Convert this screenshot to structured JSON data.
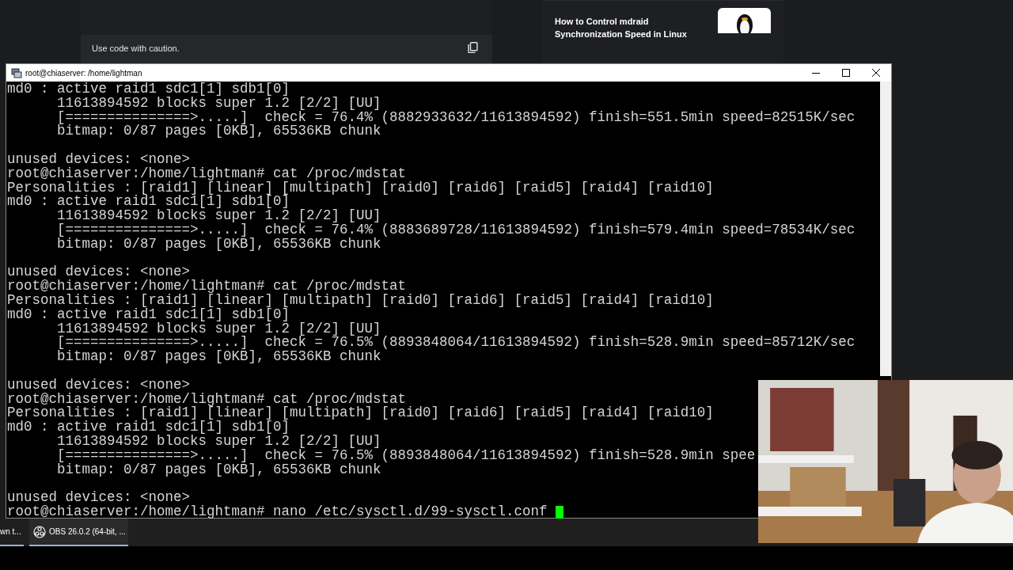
{
  "browser": {
    "code_note": "Use code with caution.",
    "article": {
      "title_lines": [
        "How to Control mdraid",
        "Synchronization Speed in Linux"
      ]
    }
  },
  "window": {
    "title": "root@chiaserver: /home/lightman"
  },
  "terminal": {
    "blocks": [
      [
        "md0 : active raid1 sdc1[1] sdb1[0]",
        "      11613894592 blocks super 1.2 [2/2] [UU]",
        "      [===============>.....]  check = 76.4% (8882933632/11613894592) finish=551.5min speed=82515K/sec",
        "      bitmap: 0/87 pages [0KB], 65536KB chunk"
      ],
      [
        "unused devices: <none>",
        "root@chiaserver:/home/lightman# cat /proc/mdstat",
        "Personalities : [raid1] [linear] [multipath] [raid0] [raid6] [raid5] [raid4] [raid10]",
        "md0 : active raid1 sdc1[1] sdb1[0]",
        "      11613894592 blocks super 1.2 [2/2] [UU]",
        "      [===============>.....]  check = 76.4% (8883689728/11613894592) finish=579.4min speed=78534K/sec",
        "      bitmap: 0/87 pages [0KB], 65536KB chunk"
      ],
      [
        "unused devices: <none>",
        "root@chiaserver:/home/lightman# cat /proc/mdstat",
        "Personalities : [raid1] [linear] [multipath] [raid0] [raid6] [raid5] [raid4] [raid10]",
        "md0 : active raid1 sdc1[1] sdb1[0]",
        "      11613894592 blocks super 1.2 [2/2] [UU]",
        "      [===============>.....]  check = 76.5% (8893848064/11613894592) finish=528.9min speed=85712K/sec",
        "      bitmap: 0/87 pages [0KB], 65536KB chunk"
      ],
      [
        "unused devices: <none>",
        "root@chiaserver:/home/lightman# cat /proc/mdstat",
        "Personalities : [raid1] [linear] [multipath] [raid0] [raid6] [raid5] [raid4] [raid10]",
        "md0 : active raid1 sdc1[1] sdb1[0]",
        "      11613894592 blocks super 1.2 [2/2] [UU]",
        "      [===============>.....]  check = 76.5% (8893848064/11613894592) finish=528.9min spee",
        "      bitmap: 0/87 pages [0KB], 65536KB chunk"
      ],
      [
        "unused devices: <none>",
        "root@chiaserver:/home/lightman# nano /etc/sysctl.d/99-sysctl.conf "
      ]
    ]
  },
  "taskbar": {
    "items": [
      {
        "label": "wn t...",
        "kind": "plain"
      },
      {
        "label": "OBS 26.0.2 (64-bit, ...",
        "kind": "obs"
      }
    ]
  }
}
